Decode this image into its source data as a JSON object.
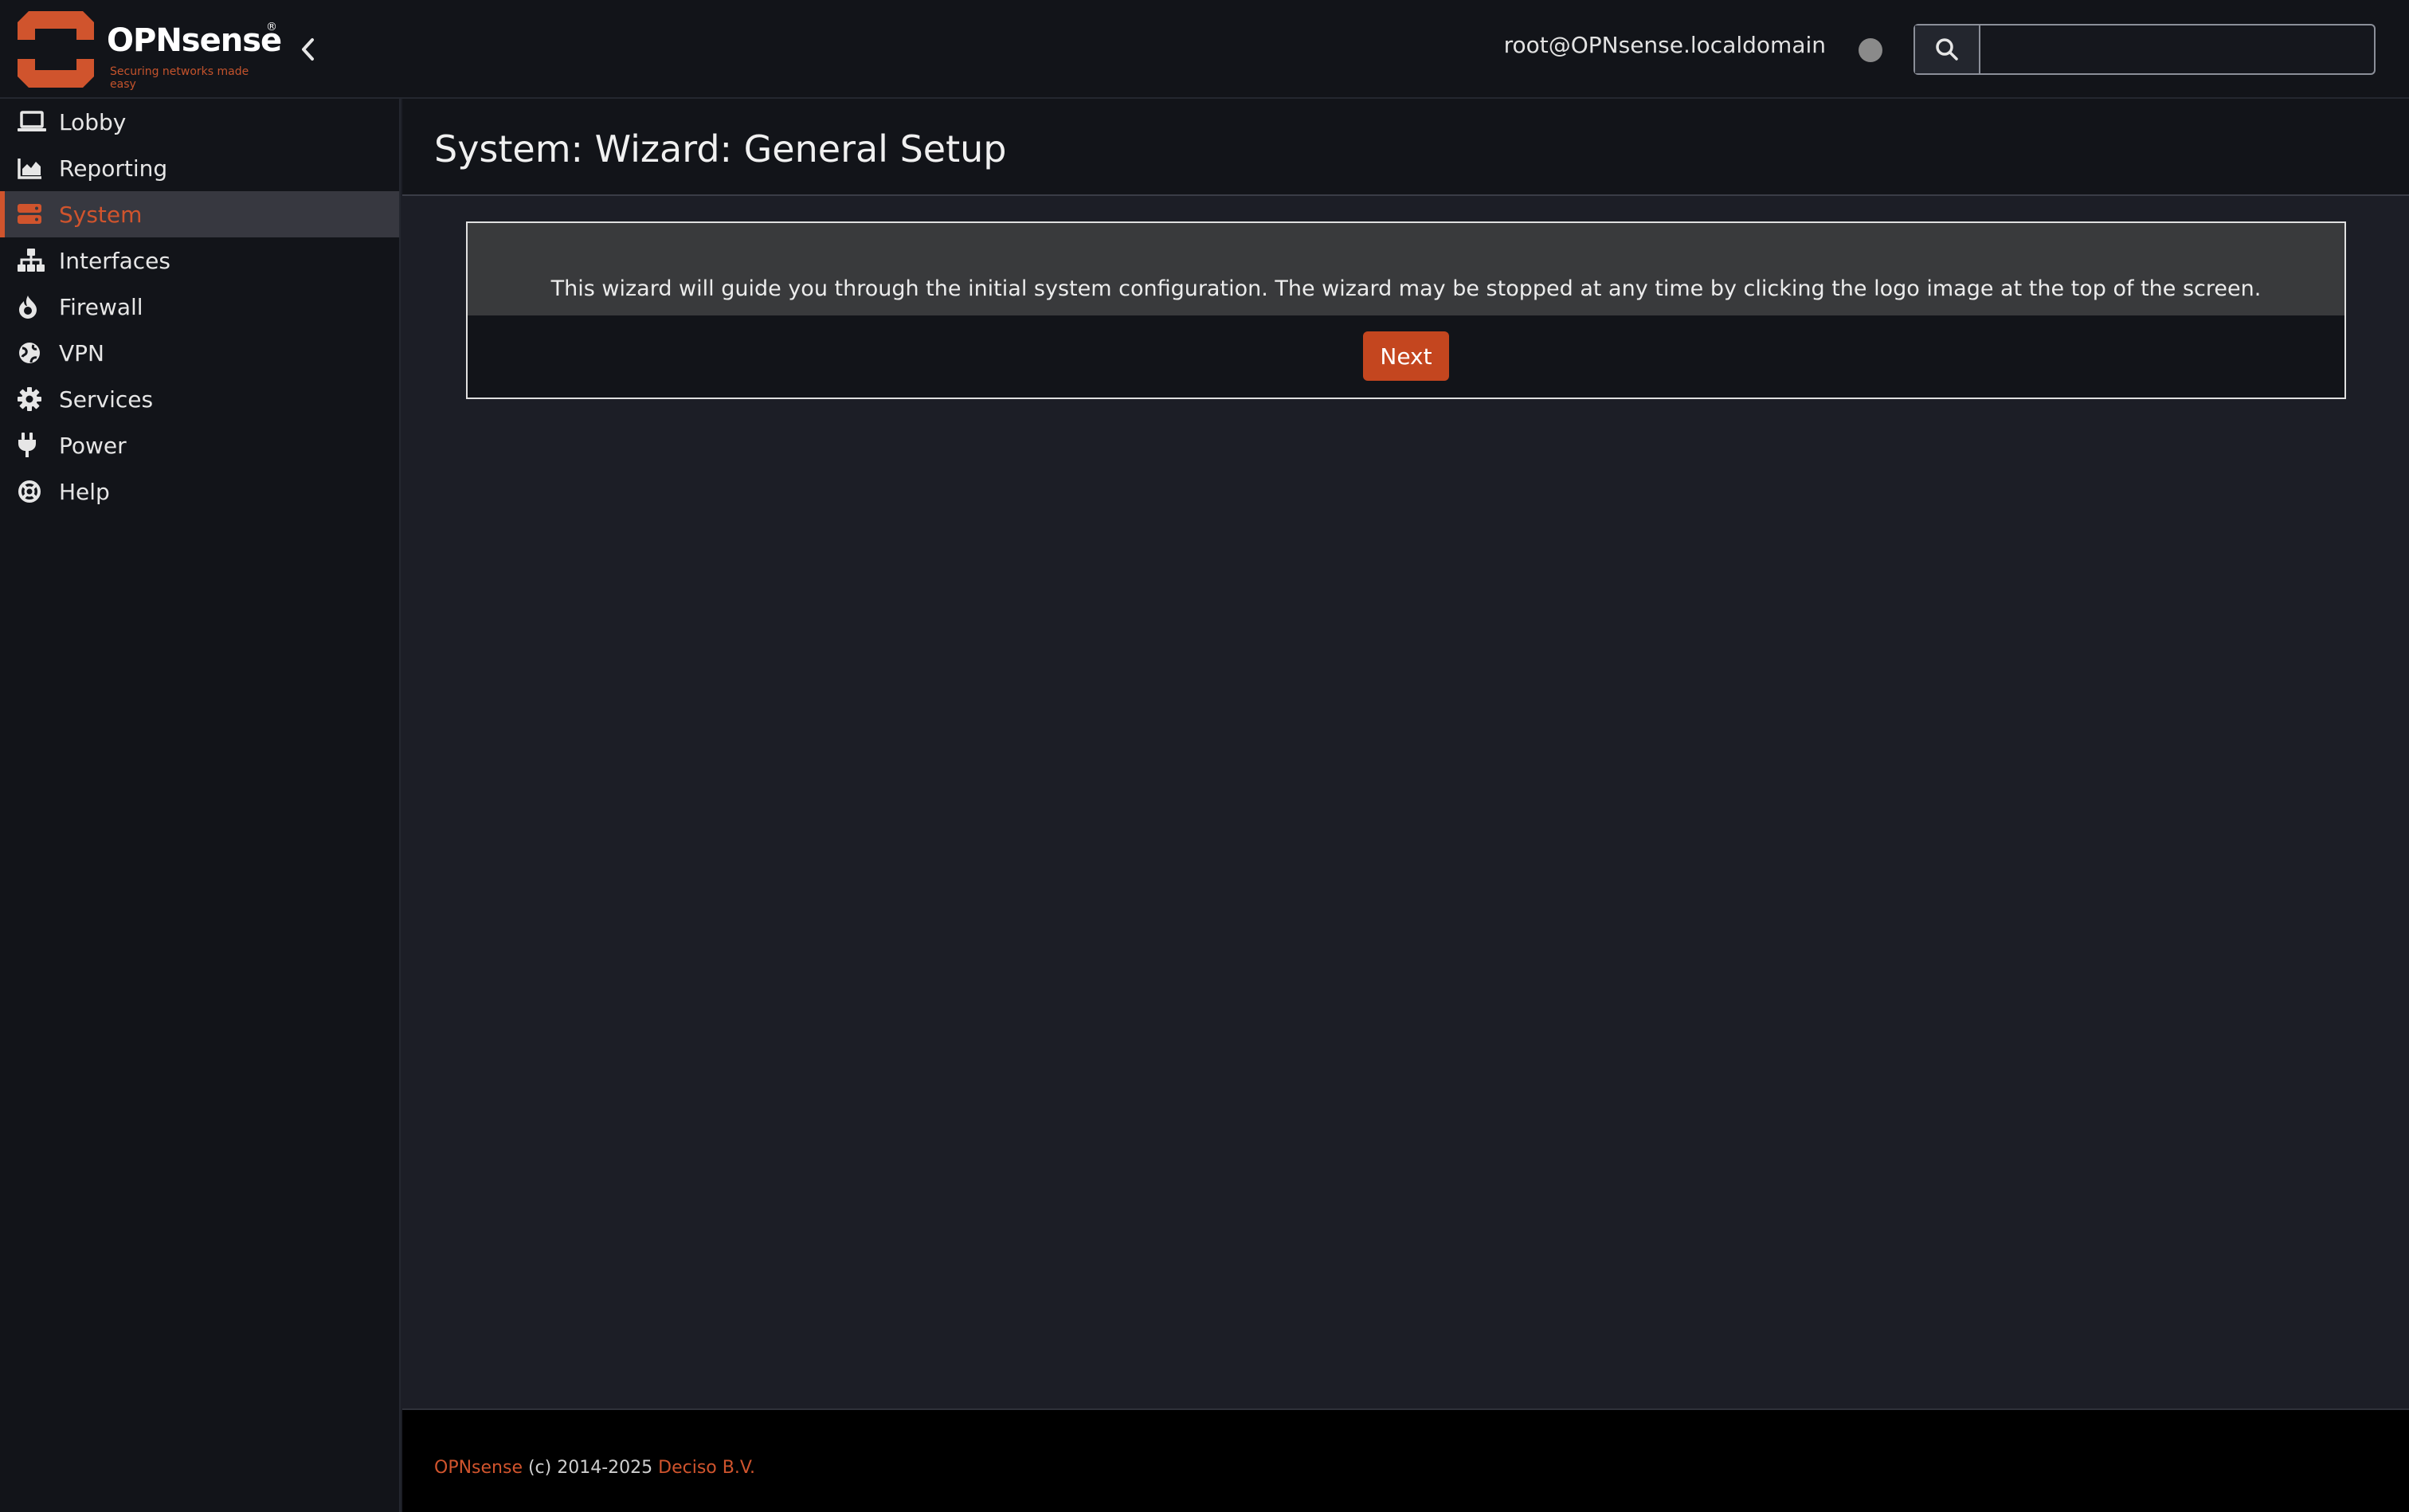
{
  "header": {
    "logo_word": "OPNsense",
    "logo_reg": "®",
    "logo_tagline": "Securing networks made easy",
    "user": "root@OPNsense.localdomain",
    "search": {
      "placeholder": "",
      "value": ""
    }
  },
  "sidebar": {
    "items": [
      {
        "label": "Lobby",
        "icon": "laptop-icon"
      },
      {
        "label": "Reporting",
        "icon": "area-chart-icon"
      },
      {
        "label": "System",
        "icon": "server-icon",
        "active": true
      },
      {
        "label": "Interfaces",
        "icon": "sitemap-icon"
      },
      {
        "label": "Firewall",
        "icon": "fire-icon"
      },
      {
        "label": "VPN",
        "icon": "globe-icon"
      },
      {
        "label": "Services",
        "icon": "gear-icon"
      },
      {
        "label": "Power",
        "icon": "plug-icon"
      },
      {
        "label": "Help",
        "icon": "lifebuoy-icon"
      }
    ]
  },
  "main": {
    "title": "System: Wizard: General Setup",
    "wizard_text": "This wizard will guide you through the initial system configuration. The wizard may be stopped at any time by clicking the logo image at the top of the screen.",
    "next_label": "Next"
  },
  "footer": {
    "brand": "OPNsense",
    "copyright": " (c) 2014-2025 ",
    "company": "Deciso B.V."
  },
  "colors": {
    "accent": "#d0542d",
    "background": "#1c1e26",
    "panel": "#121419"
  }
}
